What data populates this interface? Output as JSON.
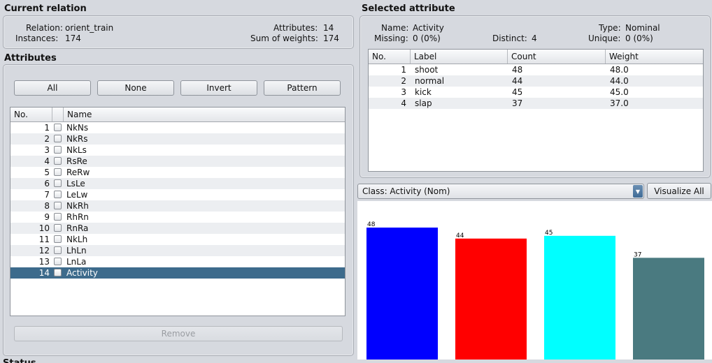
{
  "current_relation": {
    "title": "Current relation",
    "relation_label": "Relation:",
    "relation_value": "orient_train",
    "instances_label": "Instances:",
    "instances_value": "174",
    "attributes_label": "Attributes:",
    "attributes_value": "14",
    "sum_weights_label": "Sum of weights:",
    "sum_weights_value": "174"
  },
  "attributes_panel": {
    "title": "Attributes",
    "buttons": {
      "all": "All",
      "none": "None",
      "invert": "Invert",
      "pattern": "Pattern"
    },
    "headers": {
      "no": "No.",
      "name": "Name"
    },
    "rows": [
      {
        "no": "1",
        "name": "NkNs"
      },
      {
        "no": "2",
        "name": "NkRs"
      },
      {
        "no": "3",
        "name": "NkLs"
      },
      {
        "no": "4",
        "name": "RsRe"
      },
      {
        "no": "5",
        "name": "ReRw"
      },
      {
        "no": "6",
        "name": "LsLe"
      },
      {
        "no": "7",
        "name": "LeLw"
      },
      {
        "no": "8",
        "name": "NkRh"
      },
      {
        "no": "9",
        "name": "RhRn"
      },
      {
        "no": "10",
        "name": "RnRa"
      },
      {
        "no": "11",
        "name": "NkLh"
      },
      {
        "no": "12",
        "name": "LhLn"
      },
      {
        "no": "13",
        "name": "LnLa"
      },
      {
        "no": "14",
        "name": "Activity"
      }
    ],
    "remove_label": "Remove"
  },
  "selected_attribute": {
    "title": "Selected attribute",
    "name_label": "Name:",
    "name_value": "Activity",
    "type_label": "Type:",
    "type_value": "Nominal",
    "missing_label": "Missing:",
    "missing_value": "0 (0%)",
    "distinct_label": "Distinct:",
    "distinct_value": "4",
    "unique_label": "Unique:",
    "unique_value": "0 (0%)",
    "headers": {
      "no": "No.",
      "label": "Label",
      "count": "Count",
      "weight": "Weight"
    },
    "rows": [
      {
        "no": "1",
        "label": "shoot",
        "count": "48",
        "weight": "48.0"
      },
      {
        "no": "2",
        "label": "normal",
        "count": "44",
        "weight": "44.0"
      },
      {
        "no": "3",
        "label": "kick",
        "count": "45",
        "weight": "45.0"
      },
      {
        "no": "4",
        "label": "slap",
        "count": "37",
        "weight": "37.0"
      }
    ]
  },
  "class_select": {
    "value": "Class: Activity (Nom)"
  },
  "visualize_all_label": "Visualize All",
  "status_partial": "Status",
  "colors": {
    "selection": "#3d6b8c",
    "bar_1": "#0000ff",
    "bar_2": "#ff0000",
    "bar_3": "#00ffff",
    "bar_4": "#4a7a80"
  },
  "chart_data": {
    "type": "bar",
    "categories": [
      "shoot",
      "normal",
      "kick",
      "slap"
    ],
    "values": [
      48,
      44,
      45,
      37
    ],
    "colors": [
      "#0000ff",
      "#ff0000",
      "#00ffff",
      "#4a7a80"
    ],
    "ylim": [
      0,
      48
    ]
  }
}
